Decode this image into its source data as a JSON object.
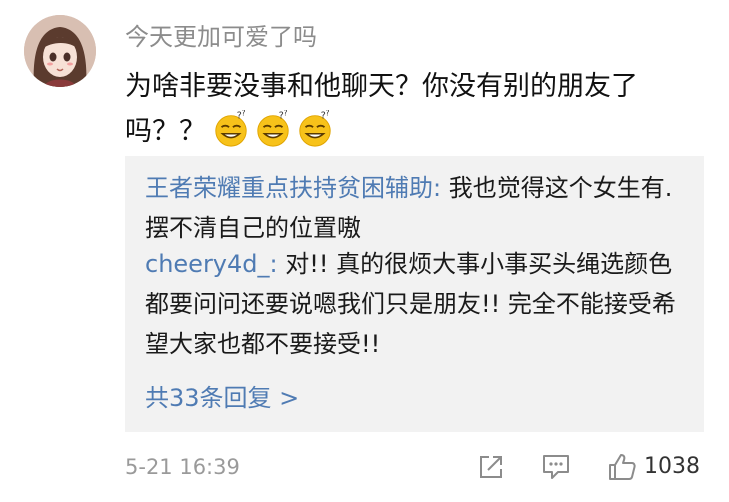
{
  "comment": {
    "username": "今天更加可爱了吗",
    "text": "为啥非要没事和他聊天？你没有别的朋友了吗？？",
    "emoji_icon": "sweat-smile-emoji",
    "emoji_count": 3
  },
  "replies": [
    {
      "user": "王者荣耀重点扶持贫困辅助:",
      "text": " 我也觉得这个女生有.摆不清自己的位置嗷"
    },
    {
      "user": "cheery4d_:",
      "text": " 对!! 真的很烦大事小事买头绳选颜色都要问问还要说嗯我们只是朋友!! 完全不能接受希望大家也都不要接受!!"
    }
  ],
  "more_replies": "共33条回复 >",
  "footer": {
    "time": "5-21 16:39",
    "like_count": "1038"
  },
  "colors": {
    "link": "#4f7bb3",
    "muted": "#9a9a9a",
    "reply_bg": "#f2f2f2",
    "emoji_yellow": "#f7c21a"
  }
}
